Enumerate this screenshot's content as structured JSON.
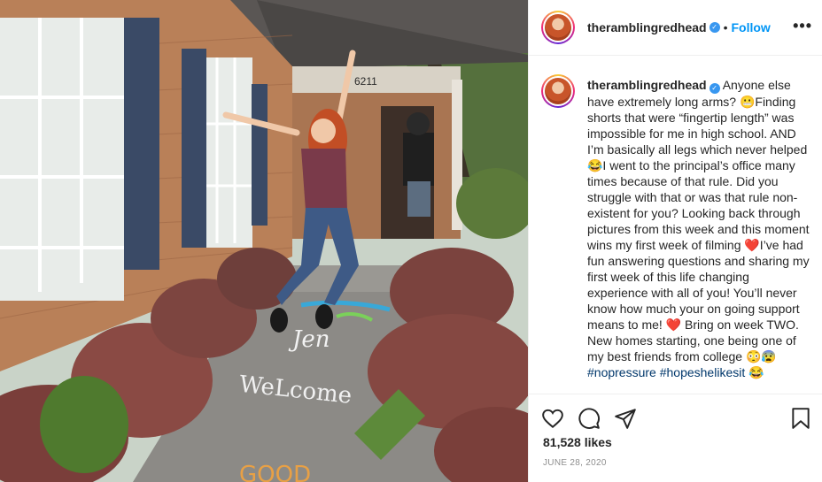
{
  "post": {
    "username": "theramblingredhead",
    "verified_mark": "✓",
    "follow_dot": "•",
    "follow_label": "Follow",
    "more_label": "•••",
    "caption_parts": [
      "Anyone else have extremely long arms? 😬Finding shorts that were “fingertip length” was impossible for me in high school. AND I’m basically all legs which never helped 😂I went to the principal’s office many times because of that rule. Did you struggle with that or was that rule non-existent for you? Looking back through pictures from this week and this moment wins my first week of filming ❤️I’ve had fun answering questions and sharing my first week of this life changing experience with all of you! You’ll never know how much your on going support means to me! ❤️ Bring on week TWO. New homes starting, one being one of my best friends from college 😳😰",
      "#nopressure",
      " ",
      "#hopeshelikesit",
      " 😂"
    ],
    "likes": "81,528 likes",
    "date": "JUNE 28, 2020",
    "icons": [
      "heart-icon",
      "comment-icon",
      "share-icon",
      "bookmark-icon"
    ]
  },
  "photo": {
    "house_number": "6211",
    "chalk_words": [
      "Jen",
      "WeLcome",
      "GOOD"
    ],
    "colors": {
      "brick": "#b57a52",
      "shutter": "#3a4a66",
      "sky": "#dfe6e6",
      "grass": "#5c7a3a"
    }
  },
  "colors": {
    "accent": "#0095f6",
    "text": "#262626",
    "muted": "#8e8e8e",
    "hashtag": "#00376b"
  }
}
